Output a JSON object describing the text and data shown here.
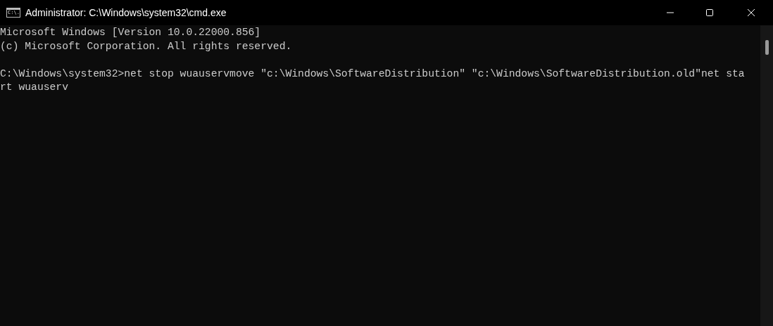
{
  "window": {
    "title": "Administrator: C:\\Windows\\system32\\cmd.exe",
    "icon_text": "C:\\."
  },
  "console": {
    "lines": [
      {
        "text": "Microsoft Windows [Version 10.0.22000.856]",
        "blank_before": false
      },
      {
        "text": "(c) Microsoft Corporation. All rights reserved.",
        "blank_before": false
      },
      {
        "text": "C:\\Windows\\system32>net stop wuauservmove \"c:\\Windows\\SoftwareDistribution\" \"c:\\Windows\\SoftwareDistribution.old\"net sta",
        "blank_before": true
      },
      {
        "text": "rt wuauserv",
        "blank_before": false
      }
    ]
  }
}
